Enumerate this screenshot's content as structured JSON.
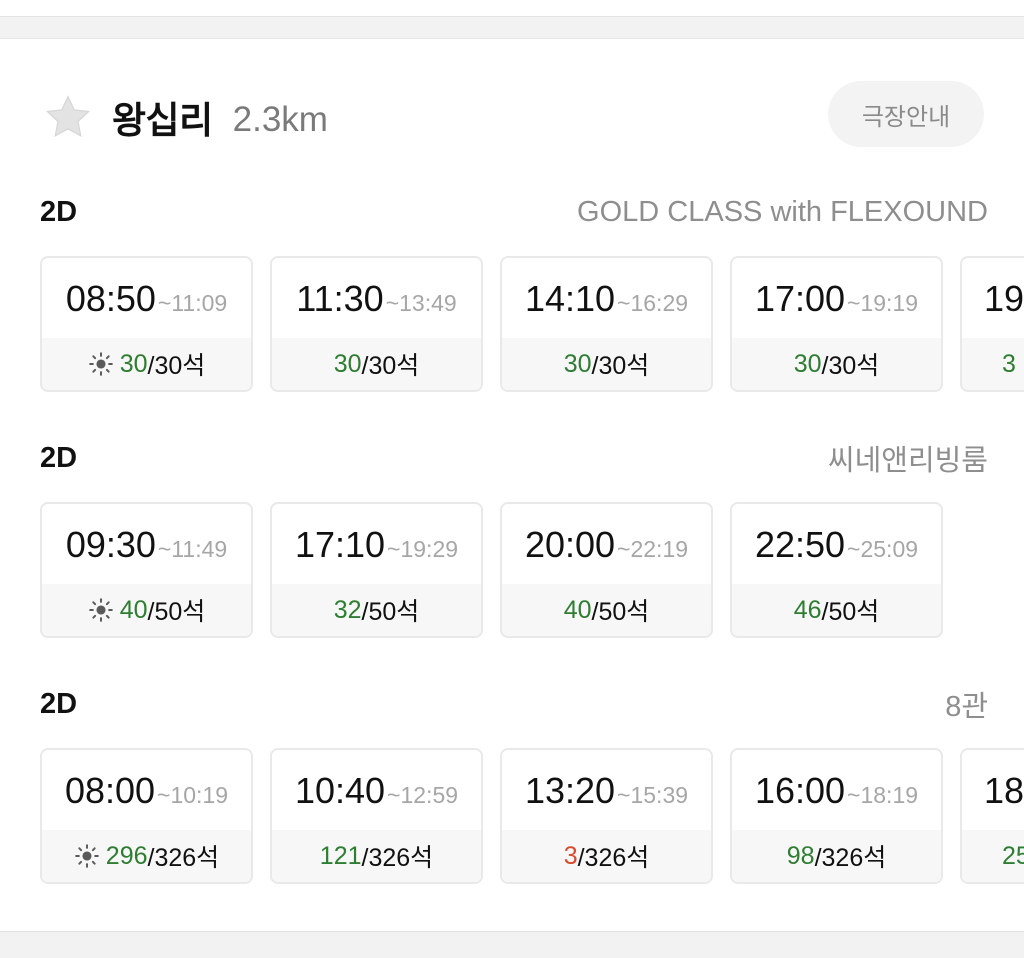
{
  "theater": {
    "name": "왕십리",
    "distance": "2.3km",
    "info_button": "극장안내"
  },
  "groups": [
    {
      "format": "2D",
      "hall": "GOLD CLASS with FLEXOUND",
      "showtimes": [
        {
          "start": "08:50",
          "end": "~11:09",
          "available": "30",
          "total": "/30석",
          "morning": true,
          "low": false
        },
        {
          "start": "11:30",
          "end": "~13:49",
          "available": "30",
          "total": "/30석",
          "morning": false,
          "low": false
        },
        {
          "start": "14:10",
          "end": "~16:29",
          "available": "30",
          "total": "/30석",
          "morning": false,
          "low": false
        },
        {
          "start": "17:00",
          "end": "~19:19",
          "available": "30",
          "total": "/30석",
          "morning": false,
          "low": false
        },
        {
          "start": "19:",
          "end": "",
          "available": "3",
          "total": "",
          "morning": false,
          "low": false
        }
      ]
    },
    {
      "format": "2D",
      "hall": "씨네앤리빙룸",
      "showtimes": [
        {
          "start": "09:30",
          "end": "~11:49",
          "available": "40",
          "total": "/50석",
          "morning": true,
          "low": false
        },
        {
          "start": "17:10",
          "end": "~19:29",
          "available": "32",
          "total": "/50석",
          "morning": false,
          "low": false
        },
        {
          "start": "20:00",
          "end": "~22:19",
          "available": "40",
          "total": "/50석",
          "morning": false,
          "low": false
        },
        {
          "start": "22:50",
          "end": "~25:09",
          "available": "46",
          "total": "/50석",
          "morning": false,
          "low": false
        }
      ]
    },
    {
      "format": "2D",
      "hall": "8관",
      "showtimes": [
        {
          "start": "08:00",
          "end": "~10:19",
          "available": "296",
          "total": "/326석",
          "morning": true,
          "low": false
        },
        {
          "start": "10:40",
          "end": "~12:59",
          "available": "121",
          "total": "/326석",
          "morning": false,
          "low": false
        },
        {
          "start": "13:20",
          "end": "~15:39",
          "available": "3",
          "total": "/326석",
          "morning": false,
          "low": true
        },
        {
          "start": "16:00",
          "end": "~18:19",
          "available": "98",
          "total": "/326석",
          "morning": false,
          "low": false
        },
        {
          "start": "18:",
          "end": "",
          "available": "25",
          "total": "",
          "morning": false,
          "low": false
        }
      ]
    }
  ],
  "colors": {
    "available_seats": "#2e7d32",
    "low_seats": "#d84a2b",
    "star": "#e3e3e3"
  },
  "icons": {
    "favorite": "star-icon",
    "morning": "sun-icon"
  }
}
